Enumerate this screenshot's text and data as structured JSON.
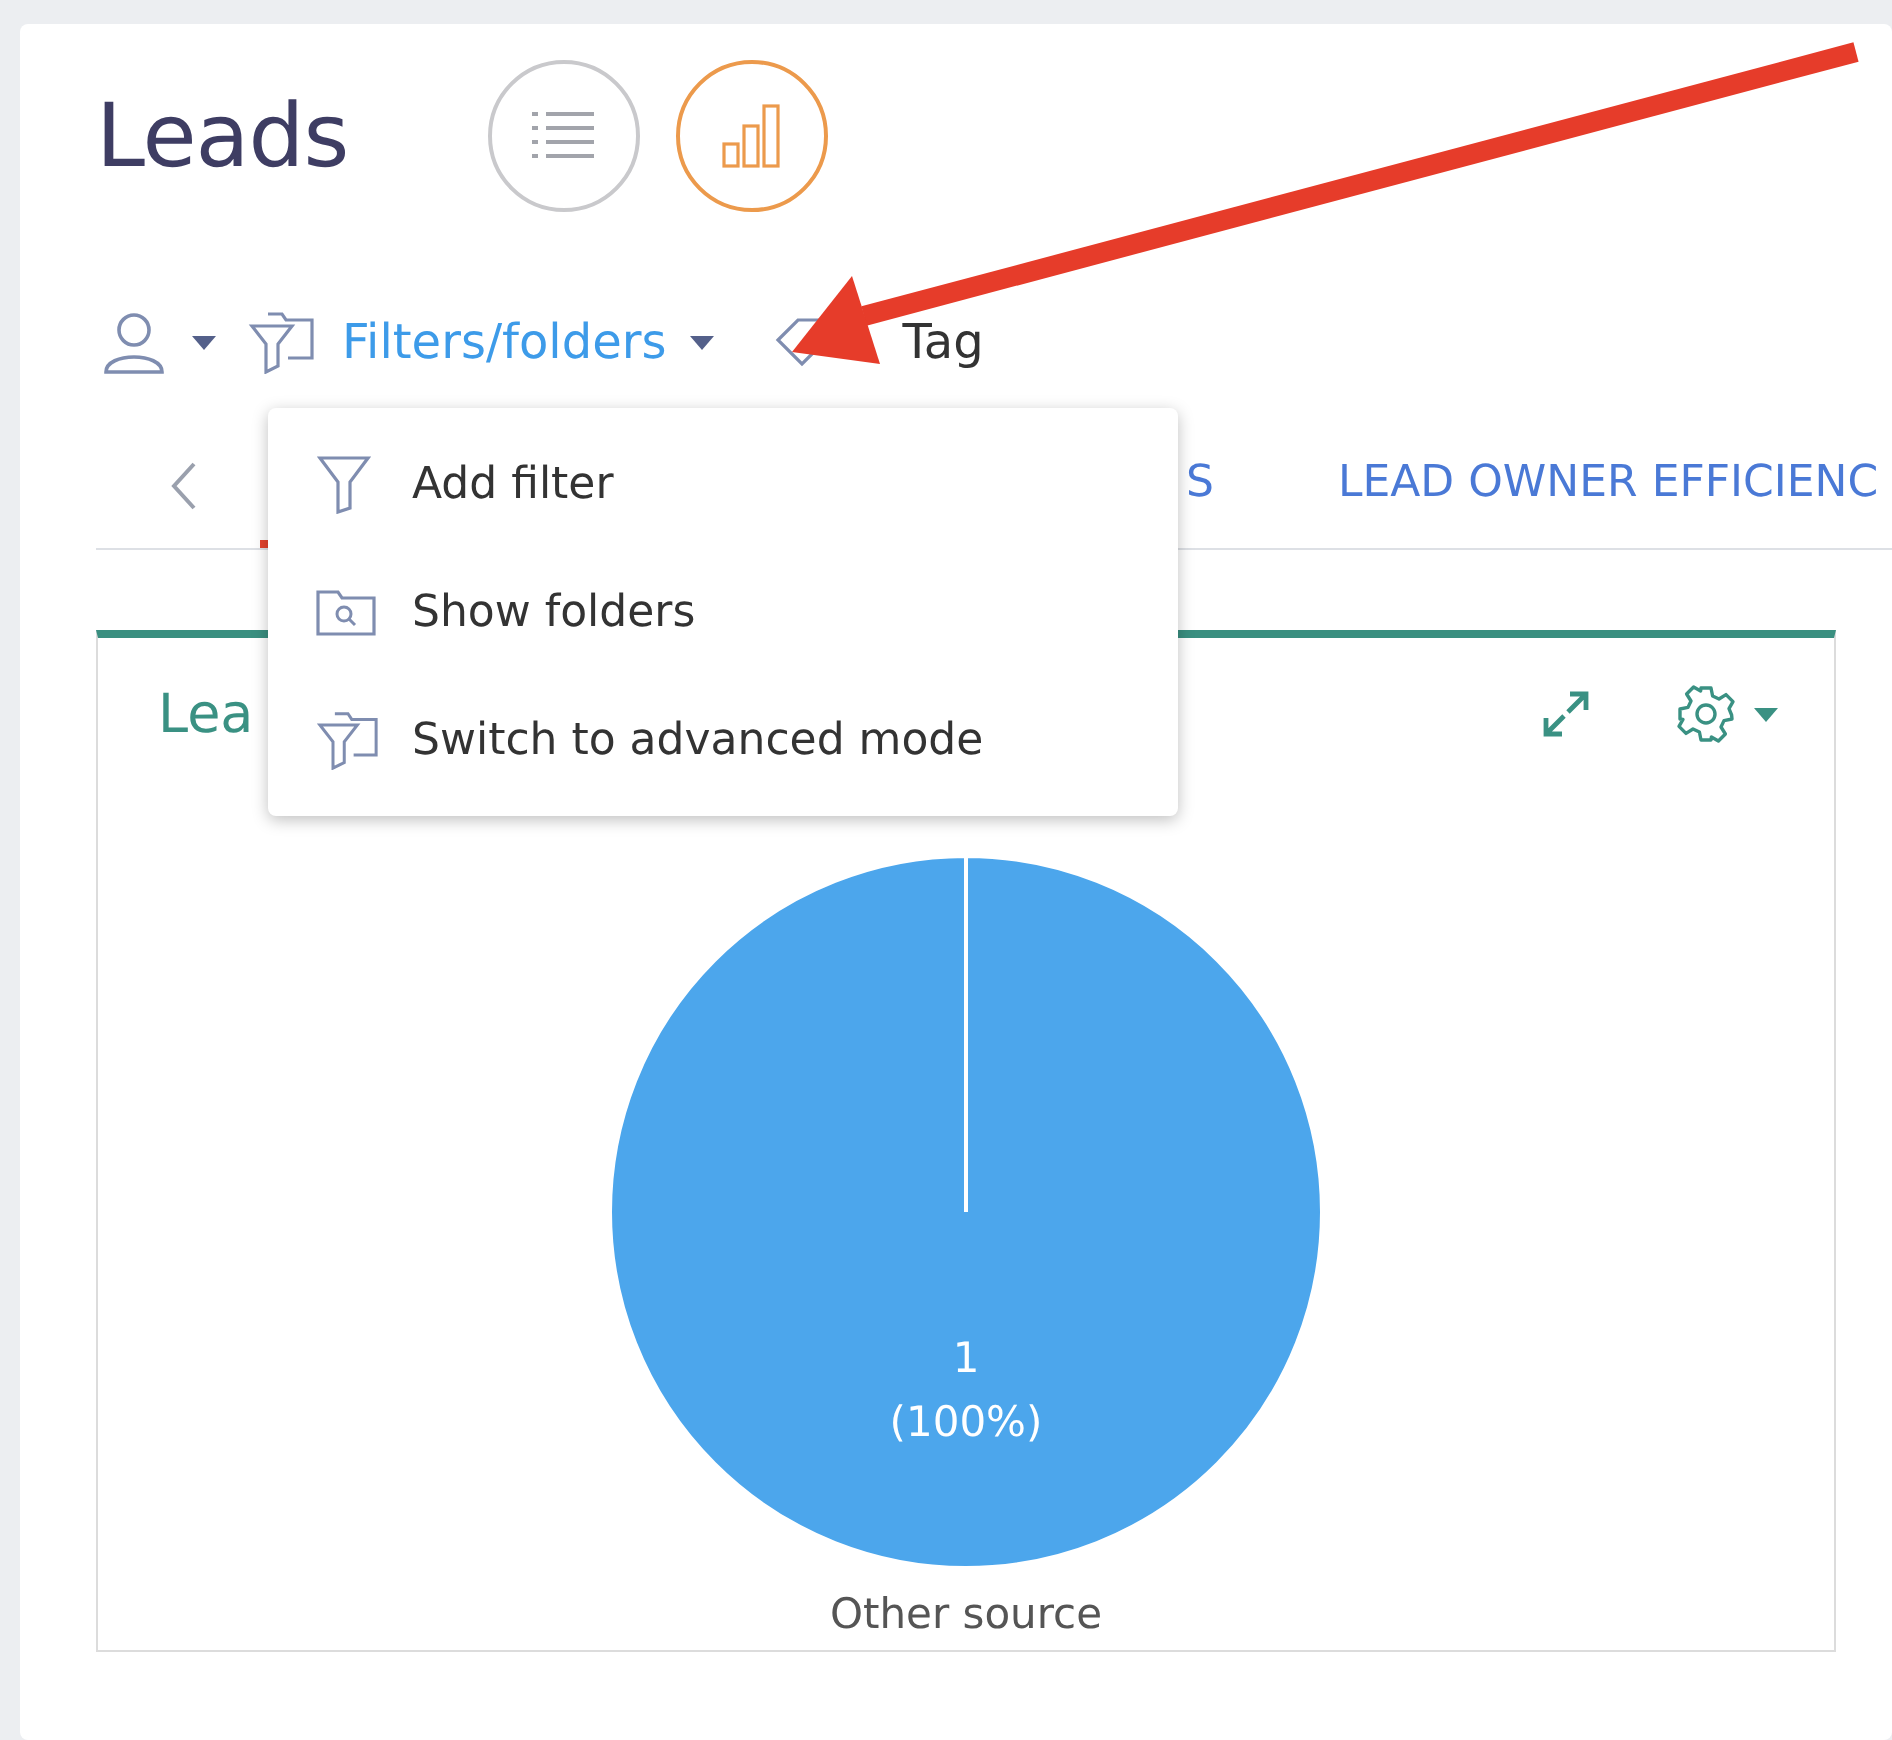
{
  "page": {
    "title": "Leads"
  },
  "view_buttons": [
    {
      "kind": "list",
      "selected": false
    },
    {
      "kind": "chart",
      "selected": true
    }
  ],
  "toolbar": {
    "filter_label": "Filters/folders",
    "tag_label": "Tag"
  },
  "filter_menu": {
    "items": [
      {
        "kind": "filter",
        "label": "Add filter"
      },
      {
        "kind": "folder",
        "label": "Show folders"
      },
      {
        "kind": "advanced",
        "label": "Switch to advanced mode"
      }
    ]
  },
  "tabs": [
    {
      "selected": true
    },
    {
      "label": "S",
      "selected": false
    },
    {
      "label": "LEAD OWNER EFFICIENC",
      "selected": false
    }
  ],
  "widget": {
    "title": "Lea",
    "chart_data": {
      "type": "pie",
      "categories": [
        "Other source"
      ],
      "series": [
        {
          "color": "#4ca6ec",
          "values": [
            1
          ]
        }
      ],
      "data_labels": true,
      "value_labels": [
        "(100%)"
      ]
    }
  }
}
